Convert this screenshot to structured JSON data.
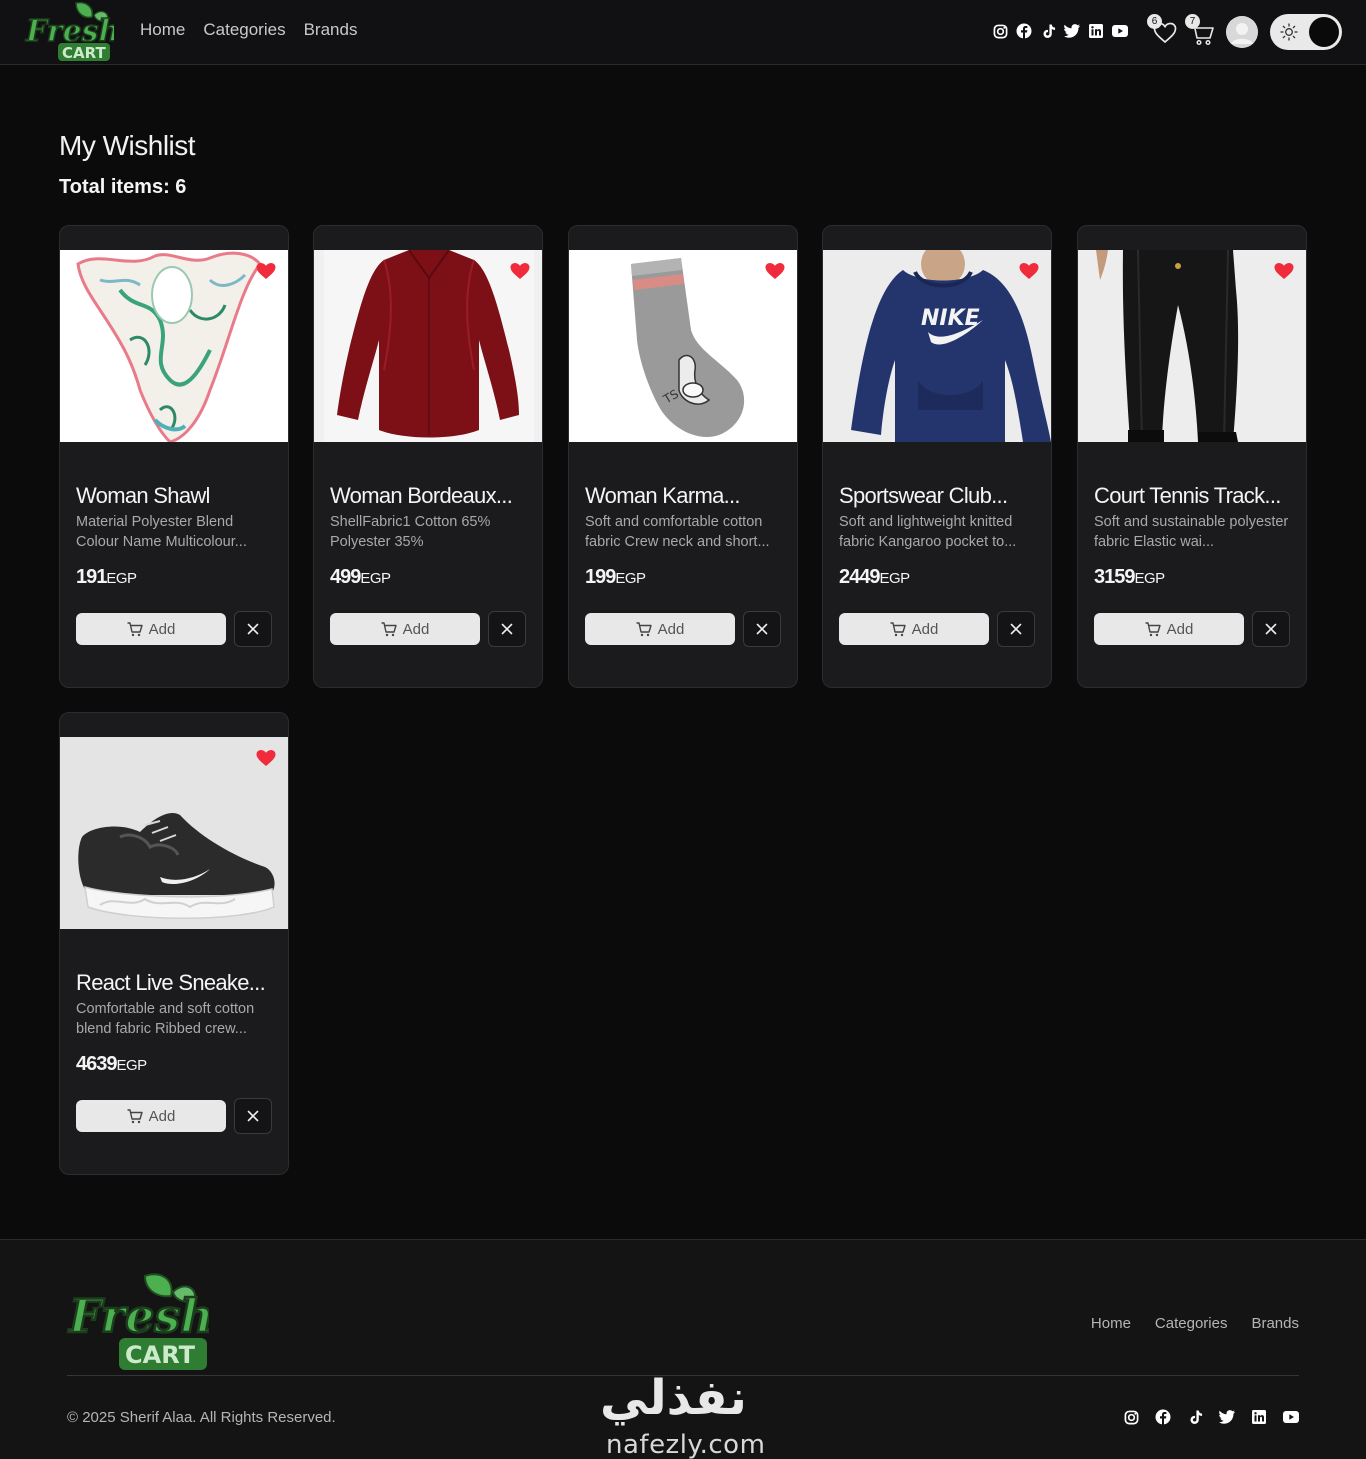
{
  "brand": {
    "logo_text_top": "Fresh",
    "logo_text_bottom": "CART"
  },
  "nav": {
    "links": [
      "Home",
      "Categories",
      "Brands"
    ]
  },
  "header_icons": {
    "social": [
      "instagram-icon",
      "facebook-icon",
      "tiktok-icon",
      "twitter-icon",
      "linkedin-icon",
      "youtube-icon"
    ],
    "wishlist_count": "6",
    "cart_count": "7"
  },
  "page": {
    "title": "My Wishlist",
    "total_items": "Total items: 6"
  },
  "products": [
    {
      "name": "Woman Shawl",
      "desc": "Material Polyester Blend Colour Name Multicolour...",
      "price": "191",
      "currency": "EGP",
      "add_label": "Add"
    },
    {
      "name": "Woman Bordeaux...",
      "desc": "ShellFabric1 Cotton 65% Polyester 35%",
      "price": "499",
      "currency": "EGP",
      "add_label": "Add"
    },
    {
      "name": "Woman Karma...",
      "desc": "Soft and comfortable cotton fabric Crew neck and short...",
      "price": "199",
      "currency": "EGP",
      "add_label": "Add"
    },
    {
      "name": "Sportswear Club...",
      "desc": "Soft and lightweight knitted fabric Kangaroo pocket to...",
      "price": "2449",
      "currency": "EGP",
      "add_label": "Add"
    },
    {
      "name": "Court Tennis Track...",
      "desc": "Soft and sustainable polyester fabric Elastic wai...",
      "price": "3159",
      "currency": "EGP",
      "add_label": "Add"
    },
    {
      "name": "React Live Sneake...",
      "desc": "Comfortable and soft cotton blend fabric Ribbed crew...",
      "price": "4639",
      "currency": "EGP",
      "add_label": "Add"
    }
  ],
  "footer": {
    "links": [
      "Home",
      "Categories",
      "Brands"
    ],
    "copyright": "© 2025 Sherif Alaa. All Rights Reserved.",
    "watermark_ar": "نفذلي",
    "watermark_lat": "nafezly.com"
  },
  "colors": {
    "background": "#0b0b0c",
    "card": "#1b1b1d",
    "heart": "#ef2b3c",
    "brand_green": "#4caf50"
  }
}
